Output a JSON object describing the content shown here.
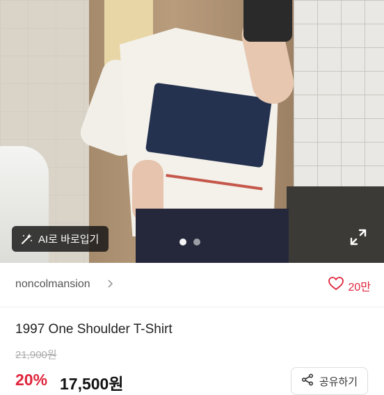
{
  "photo": {
    "ai_button_label": "AI로 바로입기",
    "carousel": {
      "count": 2,
      "active_index": 0
    }
  },
  "seller": {
    "name": "noncolmansion",
    "likes": "20만"
  },
  "product": {
    "title": "1997 One Shoulder T-Shirt",
    "original_price": "21,900원",
    "discount": "20%",
    "price": "17,500원"
  },
  "actions": {
    "share_label": "공유하기"
  },
  "colors": {
    "accent": "#e0243b"
  }
}
